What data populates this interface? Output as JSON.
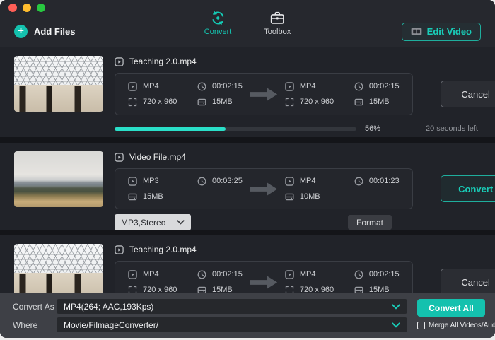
{
  "window": {
    "traffic_lights": [
      "close",
      "minimize",
      "zoom"
    ]
  },
  "header": {
    "add_files_label": "Add Files",
    "tabs": [
      {
        "label": "Convert",
        "active": true
      },
      {
        "label": "Toolbox",
        "active": false
      }
    ],
    "edit_video_label": "Edit Video"
  },
  "rows": [
    {
      "title": "Teaching 2.0.mp4",
      "source": {
        "format": "MP4",
        "duration": "00:02:15",
        "resolution": "720 x 960",
        "size": "15MB"
      },
      "target": {
        "format": "MP4",
        "duration": "00:02:15",
        "resolution": "720 x 960",
        "size": "15MB"
      },
      "action_label": "Cancel",
      "progress": {
        "percent_label": "56%",
        "fill_percent": 46,
        "time_left": "20 seconds left"
      }
    },
    {
      "title": "Video File.mp4",
      "source": {
        "format": "MP3",
        "duration": "00:03:25",
        "size": "15MB"
      },
      "target": {
        "format": "MP4",
        "duration": "00:01:23",
        "size": "10MB"
      },
      "action_label": "Convert",
      "audio_preset": "MP3,Stereo",
      "format_button_label": "Format"
    },
    {
      "title": "Teaching 2.0.mp4",
      "source": {
        "format": "MP4",
        "duration": "00:02:15",
        "resolution": "720 x 960",
        "size": "15MB"
      },
      "target": {
        "format": "MP4",
        "duration": "00:02:15",
        "resolution": "720 x 960",
        "size": "15MB"
      },
      "action_label": "Cancel"
    }
  ],
  "footer": {
    "convert_as_label": "Convert As",
    "convert_as_value": "MP4(264; AAC,193Kps)",
    "where_label": "Where",
    "where_value": "Movie/FilmageConverter/",
    "convert_all_label": "Convert All",
    "merge_label": "Merge All Videos/Audios",
    "merge_checked": false
  },
  "colors": {
    "accent_teal": "#14c1ae",
    "progress_fill": "#2adfc8",
    "card_background": "#212329",
    "footer_background": "#3e4046",
    "header_background": "#26282e",
    "traffic_red": "#ff5f57",
    "traffic_yellow": "#febc2e",
    "traffic_green": "#28c840"
  },
  "icons": {
    "add_files": "plus-circle",
    "convert_tab": "sync-arrows",
    "toolbox_tab": "toolbox-case",
    "edit_video": "film-frame",
    "file_title": "play-square",
    "format": "play-square",
    "duration": "clock",
    "resolution": "expand-corners",
    "size": "hard-drive",
    "transfer": "arrow-right",
    "dropdown": "chevron-down"
  }
}
